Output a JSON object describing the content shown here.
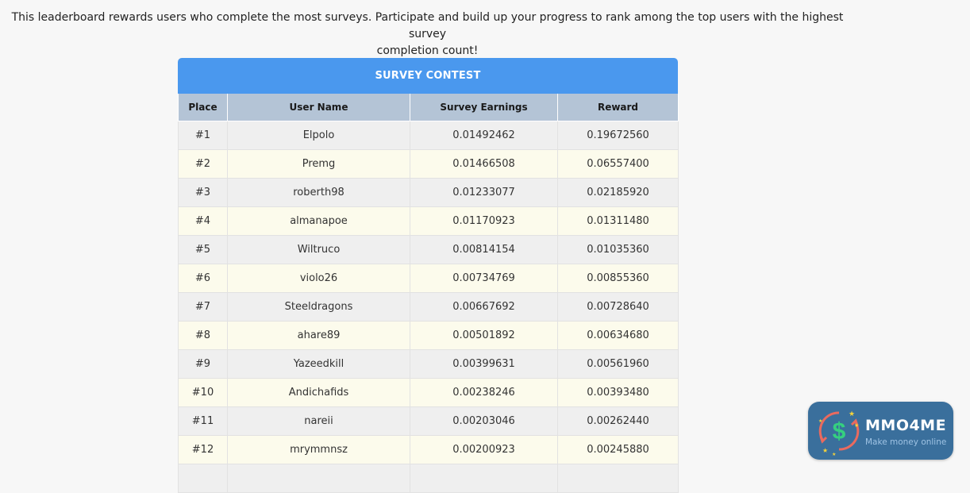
{
  "intro": {
    "line1": "This leaderboard rewards users who complete the most surveys. Participate and build up your progress to rank among the top users with the highest survey",
    "line2": "completion count!"
  },
  "contest": {
    "title": "SURVEY CONTEST",
    "columns": [
      "Place",
      "User Name",
      "Survey Earnings",
      "Reward"
    ],
    "rows": [
      {
        "place": "#1",
        "user": "Elpolo",
        "earnings": "0.01492462",
        "reward": "0.19672560"
      },
      {
        "place": "#2",
        "user": "Premg",
        "earnings": "0.01466508",
        "reward": "0.06557400"
      },
      {
        "place": "#3",
        "user": "roberth98",
        "earnings": "0.01233077",
        "reward": "0.02185920"
      },
      {
        "place": "#4",
        "user": "almanapoe",
        "earnings": "0.01170923",
        "reward": "0.01311480"
      },
      {
        "place": "#5",
        "user": "Wiltruco",
        "earnings": "0.00814154",
        "reward": "0.01035360"
      },
      {
        "place": "#6",
        "user": "violo26",
        "earnings": "0.00734769",
        "reward": "0.00855360"
      },
      {
        "place": "#7",
        "user": "Steeldragons",
        "earnings": "0.00667692",
        "reward": "0.00728640"
      },
      {
        "place": "#8",
        "user": "ahare89",
        "earnings": "0.00501892",
        "reward": "0.00634680"
      },
      {
        "place": "#9",
        "user": "Yazeedkill",
        "earnings": "0.00399631",
        "reward": "0.00561960"
      },
      {
        "place": "#10",
        "user": "Andichafids",
        "earnings": "0.00238246",
        "reward": "0.00393480"
      },
      {
        "place": "#11",
        "user": "nareii",
        "earnings": "0.00203046",
        "reward": "0.00262440"
      },
      {
        "place": "#12",
        "user": "mrymmnsz",
        "earnings": "0.00200923",
        "reward": "0.00245880"
      },
      {
        "place": "",
        "user": "",
        "earnings": "",
        "reward": ""
      }
    ]
  },
  "logo": {
    "brand": "MMO4ME",
    "tagline": "Make money online",
    "icon": "dollar-coin-icon"
  },
  "colors": {
    "header_blue": "#4a98ee",
    "column_header": "#b4c4d6",
    "row_gray": "#efefef",
    "row_cream": "#fcfbec",
    "logo_bg": "#3a6f9c"
  }
}
